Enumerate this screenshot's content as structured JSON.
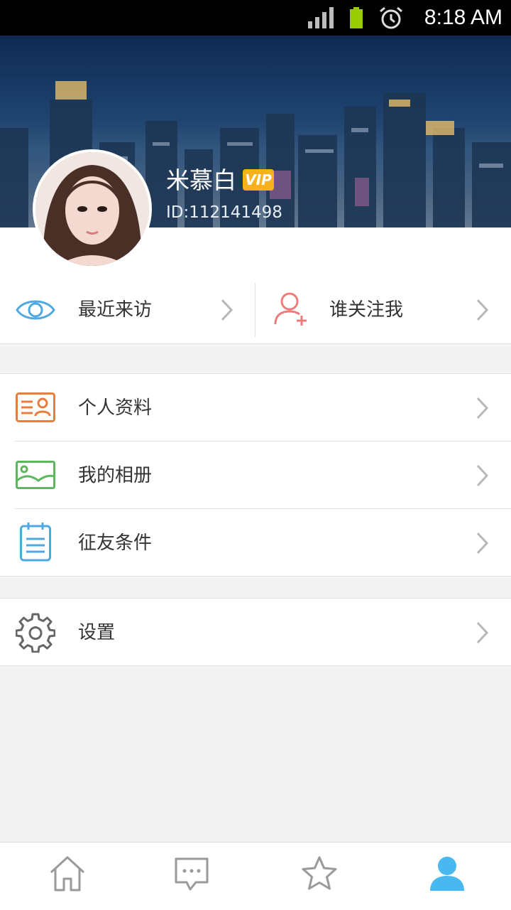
{
  "status_bar": {
    "time": "8:18 AM"
  },
  "profile": {
    "name": "米慕白",
    "vip_label": "VIP",
    "id_text": "ID:112141498"
  },
  "quick_actions": [
    {
      "label": "最近来访",
      "icon": "eye-icon"
    },
    {
      "label": "谁关注我",
      "icon": "add-user-icon"
    }
  ],
  "menu_items": [
    {
      "label": "个人资料",
      "icon": "profile-card-icon"
    },
    {
      "label": "我的相册",
      "icon": "photo-album-icon"
    },
    {
      "label": "征友条件",
      "icon": "notepad-icon"
    }
  ],
  "settings": {
    "label": "设置",
    "icon": "gear-icon"
  },
  "tabs": [
    {
      "icon": "home-icon",
      "active": false
    },
    {
      "icon": "chat-icon",
      "active": false
    },
    {
      "icon": "star-icon",
      "active": false
    },
    {
      "icon": "person-icon",
      "active": true
    }
  ],
  "colors": {
    "accent_blue": "#4fa8e0",
    "icon_orange": "#e87e3e",
    "icon_green": "#5cb85c",
    "icon_pink": "#ee7b7b",
    "vip_gold": "#f5b21c",
    "active_tab": "#4ab8f0"
  }
}
